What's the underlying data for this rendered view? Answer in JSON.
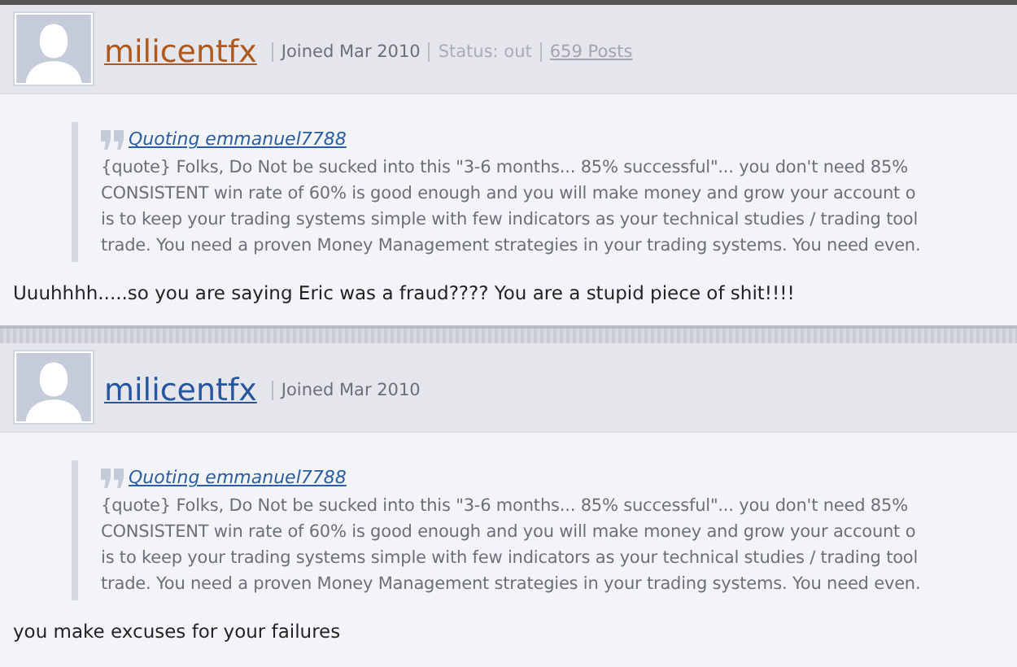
{
  "posts": [
    {
      "author": {
        "name": "milicentfx",
        "color": "#b0581c"
      },
      "meta": [
        {
          "kind": "text",
          "text": "Joined Mar 2010"
        },
        {
          "kind": "faint",
          "text": "Status: out"
        },
        {
          "kind": "link",
          "text": "659 Posts"
        }
      ],
      "quote": {
        "source": "Quoting emmanuel7788",
        "lines": [
          "{quote} Folks, Do Not be sucked into this \"3-6 months... 85% successful\"... you don't need 85%",
          "CONSISTENT win rate of 60% is good enough and you will make money and grow your account o",
          "is to keep your trading systems simple with few indicators as your technical studies / trading tool",
          "trade. You need a proven Money Management strategies in your trading systems. You need even."
        ]
      },
      "body": "Uuuhhhh.....so you are saying Eric was a fraud???? You are a stupid piece of shit!!!!"
    },
    {
      "author": {
        "name": "milicentfx",
        "color": "#2656a0"
      },
      "meta": [
        {
          "kind": "text",
          "text": "Joined Mar 2010"
        }
      ],
      "quote": {
        "source": "Quoting emmanuel7788",
        "lines": [
          "{quote} Folks, Do Not be sucked into this \"3-6 months... 85% successful\"... you don't need 85%",
          "CONSISTENT win rate of 60% is good enough and you will make money and grow your account o",
          "is to keep your trading systems simple with few indicators as your technical studies / trading tool",
          "trade. You need a proven Money Management strategies in your trading systems. You need even."
        ]
      },
      "body": "you make excuses for your failures"
    }
  ]
}
